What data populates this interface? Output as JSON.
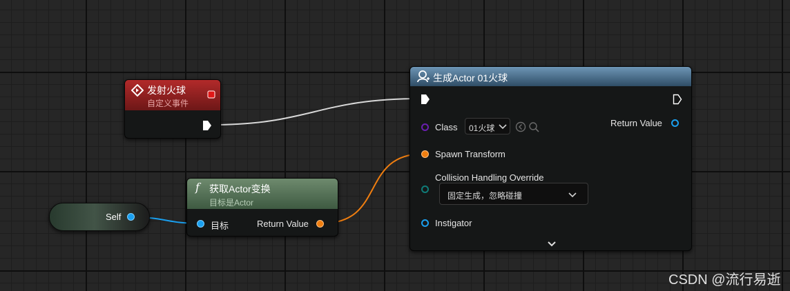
{
  "event_node": {
    "title": "发射火球",
    "subtitle": "自定义事件"
  },
  "getter_node": {
    "title": "获取Actor变换",
    "subtitle": "目标是Actor",
    "target_label": "目标",
    "return_label": "Return Value"
  },
  "self_node": {
    "label": "Self"
  },
  "spawn_node": {
    "title": "生成Actor 01火球",
    "class_label": "Class",
    "class_value": "01火球",
    "return_label": "Return Value",
    "spawn_transform_label": "Spawn Transform",
    "collision_label": "Collision Handling Override",
    "collision_value": "固定生成，忽略碰撞",
    "instigator_label": "Instigator"
  },
  "watermark": "CSDN @流行易逝",
  "colors": {
    "event_header": "#8f2020",
    "getter_header": "#55705a",
    "spawn_header": "#4c7799",
    "object_pin": "#1aa0f0",
    "transform_pin": "#f07e10",
    "class_pin": "#6a1fb0",
    "struct_pin": "#0f7c78",
    "exec_wire": "#e6e6e6"
  },
  "icons": {
    "event": "event-diamond-icon",
    "function": "function-f-icon",
    "spawn": "spawn-actor-icon",
    "delegate": "delegate-square-icon",
    "expand": "chevron-down-icon"
  }
}
